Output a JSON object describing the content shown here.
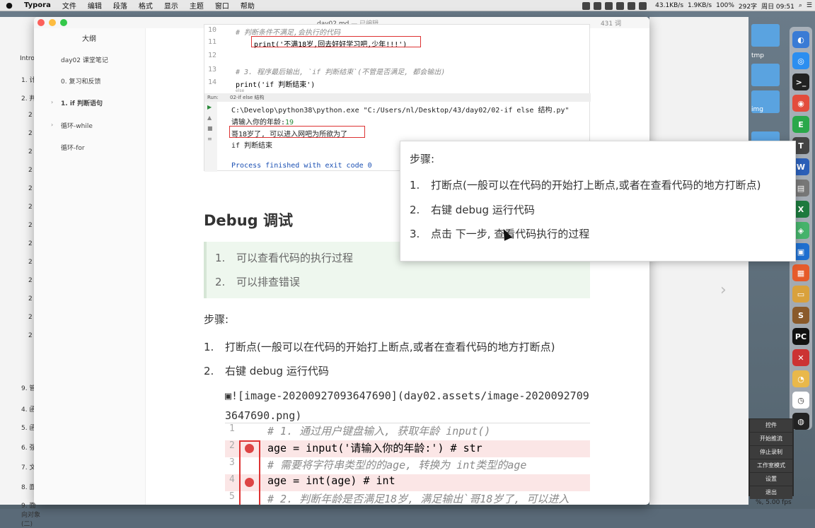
{
  "menubar": {
    "apple": "",
    "app_name": "Typora",
    "menus": [
      "文件",
      "编辑",
      "段落",
      "格式",
      "显示",
      "主题",
      "窗口",
      "帮助"
    ],
    "battery": "100%",
    "word_count": "292字",
    "clock": "周日 09:51",
    "net_up": "43.1KB/s",
    "net_down": "1.9KB/s"
  },
  "window": {
    "title": "day02.md",
    "title_sub": "— 已编辑",
    "word_count": "431 词"
  },
  "sidebar": {
    "outline_label": "大纲",
    "items": [
      "day02 课堂笔记",
      "0. 复习和反馈",
      "1. if 判断语句",
      "循环-while",
      "循环-for"
    ]
  },
  "bg_left": {
    "intro": "Intro",
    "rows": [
      "1. 计",
      "2. 判",
      "2",
      "2",
      "2",
      "2",
      "2",
      "2",
      "2",
      "2",
      "2",
      "2",
      "2",
      "2",
      "2",
      "9. 管",
      "4. 函",
      "5. 函",
      "6. 强",
      "7. 文",
      "8. 面",
      "9. 面向对象(二)"
    ]
  },
  "desktop": {
    "folder_tmp": "tmp",
    "folder_img": "img"
  },
  "codeshot": {
    "lines": [
      {
        "num": "10",
        "text": "# 判断条件不满足,会执行的代码"
      },
      {
        "num": "11",
        "text": "print('不满18岁,回去好好学习吧,少年!!!')"
      },
      {
        "num": "12",
        "text": ""
      },
      {
        "num": "13",
        "text": "# 3. 程序最后输出, `if 判断结束`(不管是否满足, 都会输出)"
      },
      {
        "num": "14",
        "text": "print('if 判断结束')"
      }
    ],
    "else_label": "else",
    "run_label": "Run:",
    "run_tab": "02-if else 结构",
    "out_cmd": "C:\\Develop\\python38\\python.exe \"C:/Users/nl/Desktop/43/day02/02-if else 结构.py\"",
    "out_prompt": "请输入你的年龄:",
    "out_input": "19",
    "out_adult": "哥18岁了, 可以进入网吧为所欲为了",
    "out_end": "if 判断结束",
    "out_exit": "Process finished with exit code 0"
  },
  "doc": {
    "heading": "Debug 调试",
    "note_items": [
      "可以查看代码的执行过程",
      "可以排查错误"
    ],
    "steps_title": "步骤:",
    "steps": [
      "打断点(一般可以在代码的开始打上断点,或者在查看代码的地方打断点)",
      "右键 debug 运行代码"
    ],
    "image_md": "![image-20200927093647690](day02.assets/image-20200927093647690.png)",
    "code_lines": [
      {
        "num": "1",
        "text": "# 1. 通过用户键盘输入, 获取年龄 input()",
        "bp": false
      },
      {
        "num": "2",
        "text": "age = input('请输入你的年龄:')   # str",
        "bp": true
      },
      {
        "num": "3",
        "text": "# 需要将字符串类型的的age, 转换为 int类型的age",
        "bp": false
      },
      {
        "num": "4",
        "text": "age = int(age)  # int",
        "bp": true
      },
      {
        "num": "5",
        "text": "# 2. 判断年龄是否满足18岁, 满足输出`哥18岁了, 可以进入",
        "bp": false
      }
    ]
  },
  "popup": {
    "title": "步骤:",
    "steps": [
      "打断点(一般可以在代码的开始打上断点,或者在查看代码的地方打断点)",
      "右键 debug 运行代码",
      "点击 下一步, 查看代码执行的过程"
    ]
  },
  "obs": {
    "controls": "控件",
    "buttons": [
      "开始推流",
      "停止录制",
      "工作室模式",
      "设置",
      "退出"
    ],
    "fps": "%, 5.00 fps"
  },
  "colors": {
    "accent_red": "#dd3333",
    "note_bg": "#eef7ee"
  }
}
